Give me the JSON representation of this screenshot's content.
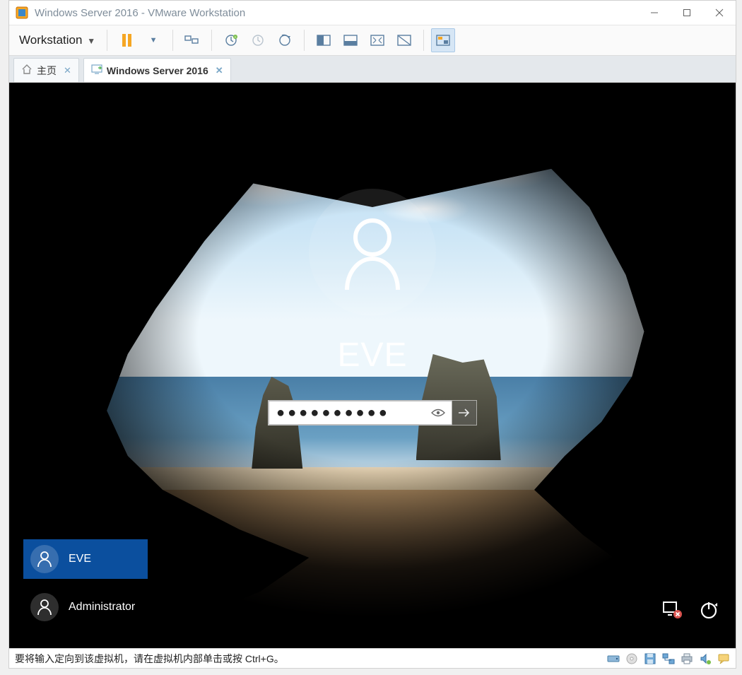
{
  "window": {
    "title": "Windows Server 2016 - VMware Workstation"
  },
  "toolbar": {
    "menu_label": "Workstation"
  },
  "tabs": {
    "home": {
      "label": "主页"
    },
    "active": {
      "label": "Windows Server 2016"
    }
  },
  "login": {
    "username": "EVE",
    "password_masked": "●●●●●●●●●●"
  },
  "users": [
    {
      "name": "EVE",
      "selected": true
    },
    {
      "name": "Administrator",
      "selected": false
    }
  ],
  "status": {
    "hint": "要将输入定向到该虚拟机，请在虚拟机内部单击或按 Ctrl+G。"
  }
}
